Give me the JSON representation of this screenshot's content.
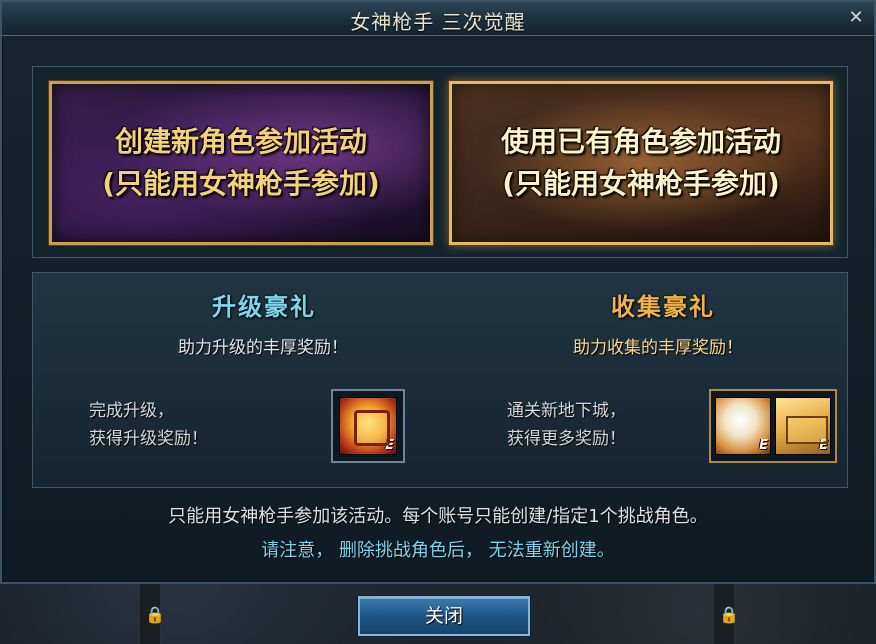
{
  "window": {
    "title": "女神枪手 三次觉醒",
    "close_glyph": "✕"
  },
  "options": {
    "create_new": {
      "line1": "创建新角色参加活动",
      "line2": "(只能用女神枪手参加)"
    },
    "use_existing": {
      "line1": "使用已有角色参加活动",
      "line2": "(只能用女神枪手参加)"
    }
  },
  "rewards": {
    "levelup": {
      "title": "升级豪礼",
      "subtitle": "助力升级的丰厚奖励！",
      "desc_line1": "完成升级，",
      "desc_line2": "获得升级奖励！",
      "icons": [
        {
          "name": "reward-box-icon",
          "badge": "E"
        }
      ]
    },
    "collect": {
      "title": "收集豪礼",
      "subtitle": "助力收集的丰厚奖励！",
      "desc_line1": "通关新地下城，",
      "desc_line2": "获得更多奖励！",
      "icons": [
        {
          "name": "reward-orb-icon",
          "badge": "E"
        },
        {
          "name": "reward-chest-icon",
          "badge": "E"
        }
      ]
    }
  },
  "notes": {
    "line1": "只能用女神枪手参加该活动。每个账号只能创建/指定1个挑战角色。",
    "line2": "请注意， 删除挑战角色后， 无法重新创建。"
  },
  "footer": {
    "close_label": "关闭",
    "lock_glyph": "🔒"
  },
  "colors": {
    "accent_gold": "#f5d27a",
    "accent_cyan": "#7ed6ef",
    "accent_orange": "#f0b34a",
    "button_blue": "#1f5685"
  }
}
